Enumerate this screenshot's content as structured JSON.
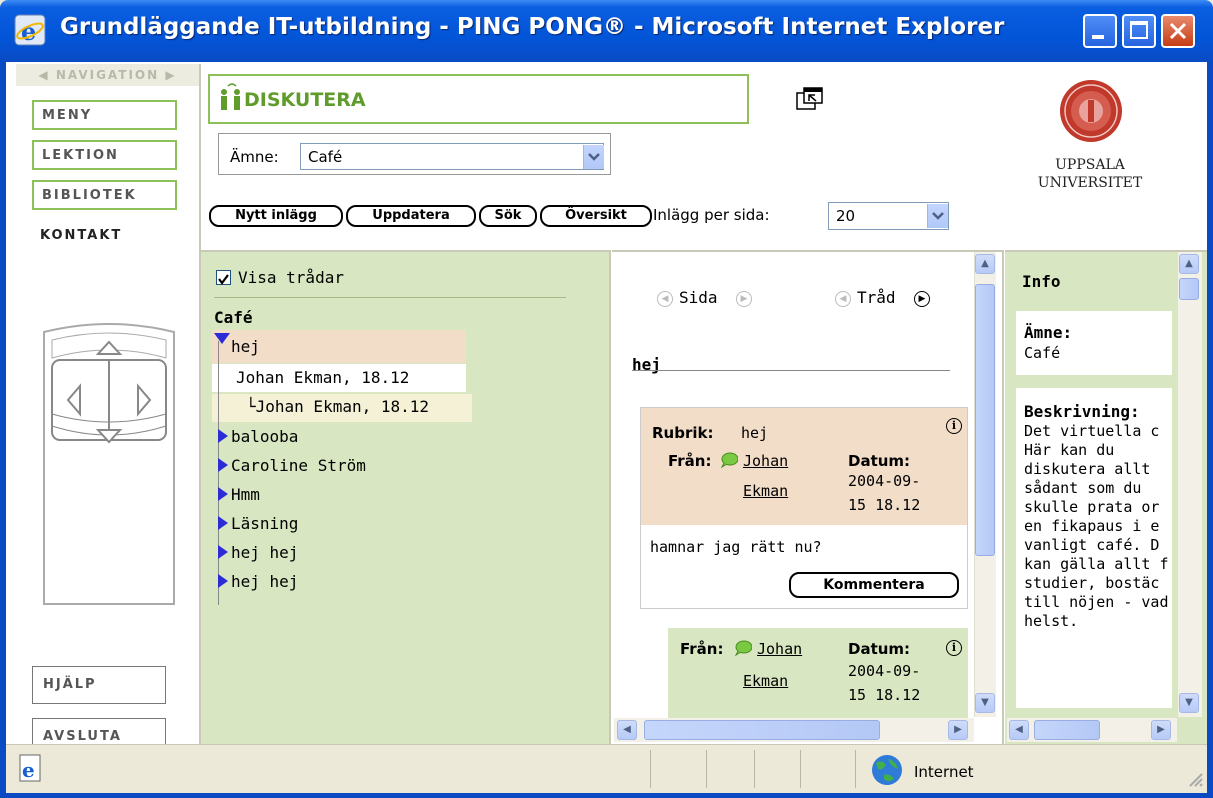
{
  "window": {
    "title": "Grundläggande IT-utbildning - PING PONG® - Microsoft Internet Explorer"
  },
  "nav": {
    "header": "◀ NAVIGATION ▶",
    "items": [
      "MENY",
      "LEKTION",
      "BIBLIOTEK"
    ],
    "current": "KONTAKT",
    "help": "HJÄLP",
    "exit": "AVSLUTA"
  },
  "toolbar": {
    "section_title": "DISKUTERA",
    "topic_label": "Ämne:",
    "topic_value": "Café",
    "buttons": [
      "Nytt inlägg",
      "Uppdatera",
      "Sök",
      "Översikt"
    ],
    "perpage_label": "Inlägg per sida:",
    "perpage_value": "20"
  },
  "logo": {
    "line1": "UPPSALA",
    "line2": "UNIVERSITET"
  },
  "threads": {
    "show_threads_label": "Visa trådar",
    "show_threads_checked": true,
    "forum": "Café",
    "items": [
      {
        "label": "hej",
        "selected": true
      },
      {
        "label": "Johan Ekman, 18.12"
      },
      {
        "label": "└Johan Ekman, 18.12"
      },
      {
        "label": "balooba"
      },
      {
        "label": "Caroline Ström"
      },
      {
        "label": "Hmm"
      },
      {
        "label": "Läsning"
      },
      {
        "label": "hej hej"
      },
      {
        "label": "hej hej"
      }
    ]
  },
  "messages": {
    "page_label": "Sida",
    "thread_label": "Tråd",
    "thread_title": "hej",
    "post1": {
      "subject_label": "Rubrik:",
      "subject": "hej",
      "from_label": "Från:",
      "author_first": "Johan",
      "author_last": "Ekman",
      "date_label": "Datum:",
      "date_line1": "2004-09-",
      "date_line2": "15 18.12",
      "body": "hamnar jag rätt nu?",
      "comment_button": "Kommentera"
    },
    "post2": {
      "from_label": "Från:",
      "author_first": "Johan",
      "author_last": "Ekman",
      "date_label": "Datum:",
      "date_line1": "2004-09-",
      "date_line2": "15 18.12"
    }
  },
  "info": {
    "header": "Info",
    "topic_label": "Ämne:",
    "topic_value": "Café",
    "desc_label": "Beskrivning:",
    "desc_lines": [
      "Det virtuella c",
      "Här kan du",
      "diskutera allt",
      "sådant som du",
      "skulle prata or",
      "en fikapaus i e",
      "vanligt café. D",
      "kan gälla allt f",
      "studier, bostäc",
      "till nöjen - vad",
      "helst."
    ]
  },
  "status": {
    "zone": "Internet"
  },
  "colors": {
    "titlebar": "#0a5ee0",
    "green_accent": "#5f9c2b",
    "green_panel": "#d8e7c2",
    "post_head": "#f2ddc8"
  }
}
